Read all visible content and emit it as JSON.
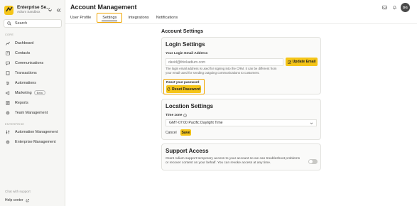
{
  "app": {
    "org_name": "Enterprise Se...",
    "org_sub": "Adium Sandbox",
    "search_placeholder": "Search"
  },
  "sidebar": {
    "sections": {
      "main_label": "CORE",
      "enterprise_label": "ENTERPRISE"
    },
    "items": [
      {
        "label": "Dashboard",
        "icon": "dashboard-icon"
      },
      {
        "label": "Contacts",
        "icon": "contacts-icon"
      },
      {
        "label": "Communications",
        "icon": "chat-icon"
      },
      {
        "label": "Transactions",
        "icon": "receipt-icon"
      },
      {
        "label": "Automations",
        "icon": "automation-icon"
      },
      {
        "label": "Marketing",
        "icon": "megaphone-icon",
        "badge": "Beta"
      },
      {
        "label": "Reports",
        "icon": "report-icon"
      },
      {
        "label": "Team Management",
        "icon": "gear-icon"
      }
    ],
    "enterprise_items": [
      {
        "label": "Automation Management",
        "icon": "sliders-icon"
      },
      {
        "label": "Enterprise Management",
        "icon": "gear-icon"
      }
    ],
    "footer": {
      "support": "Chat with support",
      "help": "Help center"
    }
  },
  "header": {
    "title": "Account Management",
    "avatar_initials": "DG",
    "tabs": [
      {
        "label": "User Profile"
      },
      {
        "label": "Settings",
        "active": true
      },
      {
        "label": "Integrations"
      },
      {
        "label": "Notifications"
      }
    ]
  },
  "main": {
    "section_title": "Account Settings",
    "login": {
      "title": "Login Settings",
      "email_label": "Your Login Email Address",
      "email_value": "david@thinkadium.com",
      "update_button": "Update Email",
      "help_text": "The login email address is used for signing into the CRM. It can be different from your email used for sending outgoing communications to customers.",
      "reset_label": "Reset your password",
      "reset_button": "Reset Password"
    },
    "location": {
      "title": "Location Settings",
      "timezone_label": "Time zone",
      "timezone_value": "GMT-07:00 Pacific Daylight Time",
      "cancel": "Cancel",
      "save": "Save"
    },
    "support": {
      "title": "Support Access",
      "text": "Grant Adium support temporary access to your account so we can troubleshoot problems or recover content on your behalf. You can revoke access at any time.",
      "toggle_on": false
    }
  },
  "colors": {
    "accent": "#f5c518",
    "highlight": "#f0a500",
    "sidebar_bg": "#f6f6f4"
  }
}
